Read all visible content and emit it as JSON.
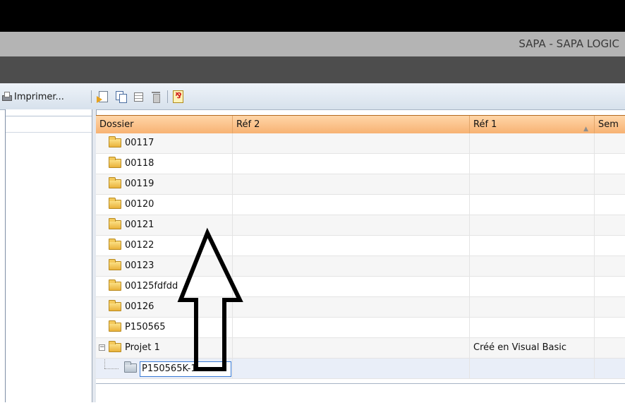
{
  "window": {
    "title": "SAPA - SAPA LOGIC"
  },
  "toolbar": {
    "print_label": "Imprimer...",
    "icons": [
      "printer-icon",
      "export-document-icon",
      "copy-icon",
      "grid-view-icon",
      "trash-icon",
      "pdf-icon"
    ]
  },
  "grid": {
    "columns": [
      {
        "label": "Dossier"
      },
      {
        "label": "Réf 2"
      },
      {
        "label": "Réf 1",
        "sort": "▲"
      },
      {
        "label": "Sem"
      }
    ],
    "rows": [
      {
        "dossier": "00117",
        "ref2": "",
        "ref1": ""
      },
      {
        "dossier": "00118",
        "ref2": "",
        "ref1": ""
      },
      {
        "dossier": "00119",
        "ref2": "",
        "ref1": ""
      },
      {
        "dossier": "00120",
        "ref2": "",
        "ref1": ""
      },
      {
        "dossier": "00121",
        "ref2": "",
        "ref1": ""
      },
      {
        "dossier": "00122",
        "ref2": "",
        "ref1": ""
      },
      {
        "dossier": "00123",
        "ref2": "",
        "ref1": ""
      },
      {
        "dossier": "00125fdfdd",
        "ref2": "",
        "ref1": ""
      },
      {
        "dossier": "00126",
        "ref2": "",
        "ref1": ""
      },
      {
        "dossier": "P150565",
        "ref2": "",
        "ref1": ""
      },
      {
        "dossier": "Projet 1",
        "ref2": "",
        "ref1": "Créé en Visual Basic",
        "expander": "−"
      },
      {
        "dossier": "P150565K-1",
        "ref2": "",
        "ref1": "",
        "editing": true
      }
    ]
  },
  "colors": {
    "header_orange": "#f7b273",
    "title_gray": "#b4b4b4",
    "dark_bar": "#4d4d4d",
    "selection_blue": "#e9eef8"
  }
}
